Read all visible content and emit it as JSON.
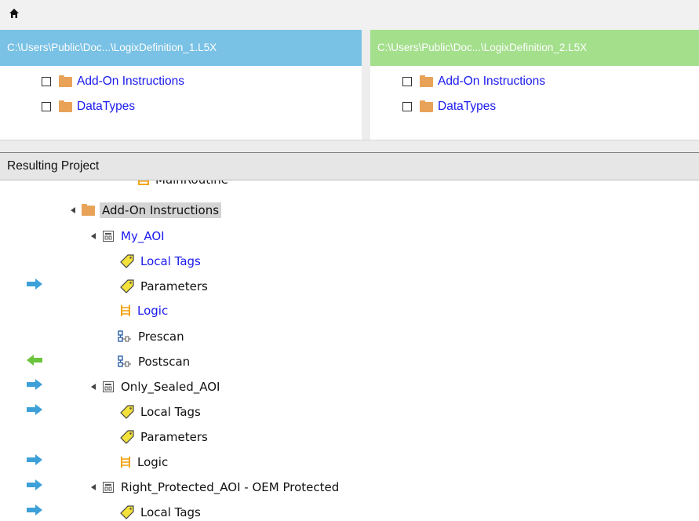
{
  "toolbar": {
    "home_icon": "home-icon"
  },
  "panes": {
    "left": {
      "path": "C:\\Users\\Public\\Doc...\\LogixDefinition_1.L5X",
      "items": [
        {
          "label": "Add-On Instructions"
        },
        {
          "label": "DataTypes"
        }
      ]
    },
    "right": {
      "path": "C:\\Users\\Public\\Doc...\\LogixDefinition_2.L5X",
      "items": [
        {
          "label": "Add-On Instructions"
        },
        {
          "label": "DataTypes"
        }
      ]
    }
  },
  "resulting": {
    "title": "Resulting Project",
    "partial_row": "MainRoutine",
    "rows": [
      {
        "label": "Add-On Instructions",
        "icon": "folder-icon",
        "arrow": ""
      },
      {
        "label": "My_AOI",
        "icon": "aoi-icon",
        "arrow": ""
      },
      {
        "label": "Local Tags",
        "icon": "tag-icon",
        "arrow": ""
      },
      {
        "label": "Parameters",
        "icon": "tag-icon",
        "arrow": "right"
      },
      {
        "label": "Logic",
        "icon": "logic-icon",
        "arrow": ""
      },
      {
        "label": "Prescan",
        "icon": "scan-icon",
        "arrow": ""
      },
      {
        "label": "Postscan",
        "icon": "scan-icon",
        "arrow": "left"
      },
      {
        "label": "Only_Sealed_AOI",
        "icon": "aoi-icon",
        "arrow": "right"
      },
      {
        "label": "Local Tags",
        "icon": "tag-icon",
        "arrow": "right"
      },
      {
        "label": "Parameters",
        "icon": "tag-icon",
        "arrow": ""
      },
      {
        "label": "Logic",
        "icon": "logic-icon",
        "arrow": "right"
      },
      {
        "label": "Right_Protected_AOI - OEM Protected",
        "icon": "aoi-icon",
        "arrow": "right"
      },
      {
        "label": "Local Tags",
        "icon": "tag-icon",
        "arrow": "right"
      }
    ]
  },
  "colors": {
    "left_header": "#79c1e5",
    "right_header": "#a4df8c",
    "link_blue": "#1a1aee",
    "arrow_blue": "#3da0d8",
    "arrow_green": "#6cc43c",
    "tag_yellow": "#f3e13c",
    "logic_orange": "#f2a417"
  }
}
